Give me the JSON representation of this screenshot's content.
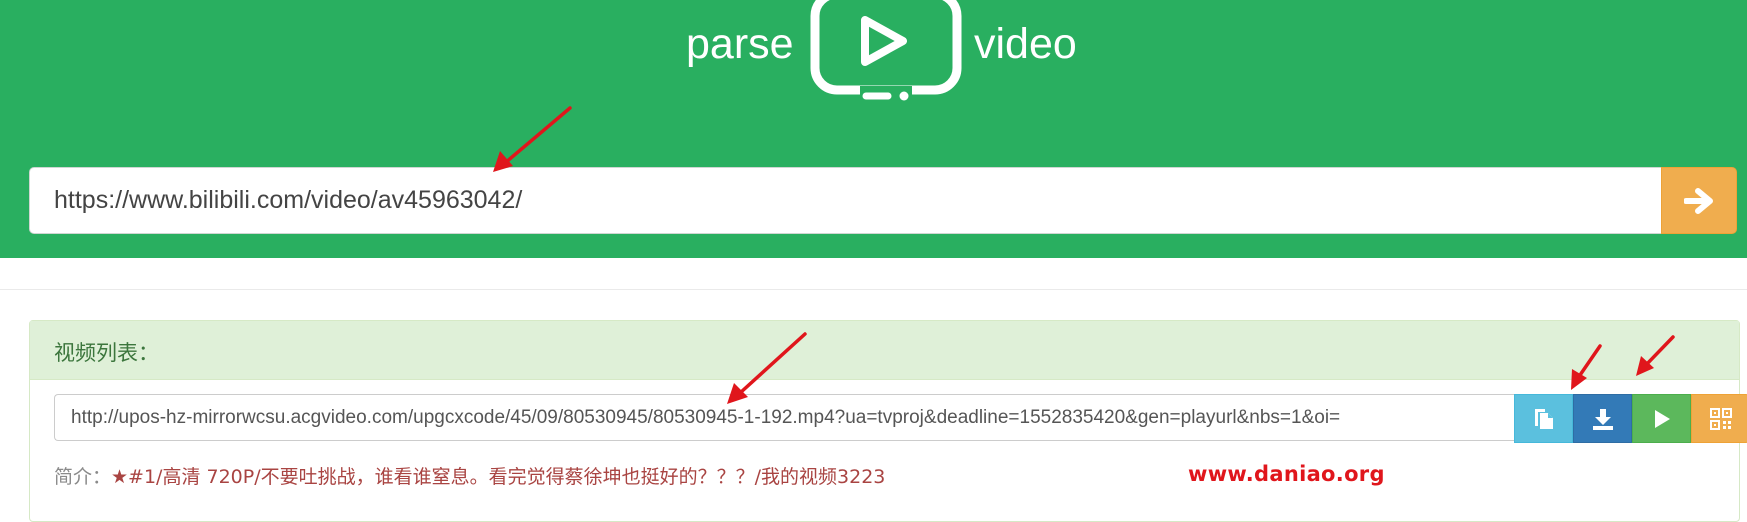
{
  "brand": {
    "left_word": "parse",
    "right_word": "video",
    "logo_icon": "play-screen-icon"
  },
  "search": {
    "value": "https://www.bilibili.com/video/av45963042/",
    "submit_icon": "arrow-right-icon",
    "button_color": "#f0ad4e"
  },
  "panel": {
    "title": "视频列表：",
    "url_value": "http://upos-hz-mirrorwcsu.acgvideo.com/upgcxcode/45/09/80530945/80530945-1-192.mp4?ua=tvproj&deadline=1552835420&gen=playurl&nbs=1&oi=",
    "actions": [
      {
        "name": "copy-button",
        "icon": "copy-icon",
        "color": "#5bc0de"
      },
      {
        "name": "download-button",
        "icon": "download-icon",
        "color": "#337ab7"
      },
      {
        "name": "play-button",
        "icon": "play-icon",
        "color": "#5cb85c"
      },
      {
        "name": "qrcode-button",
        "icon": "qrcode-icon",
        "color": "#f0ad4e"
      }
    ],
    "desc_label": "简介：",
    "desc_text": "★#1/高清 720P/不要吐挑战，谁看谁窒息。看完觉得蔡徐坤也挺好的？？？/我的视频3223"
  },
  "watermark": "www.daniao.org",
  "colors": {
    "hero_bg": "#29af60",
    "panel_heading_bg": "#dff0d8",
    "annotation_arrow": "#e0161c"
  }
}
